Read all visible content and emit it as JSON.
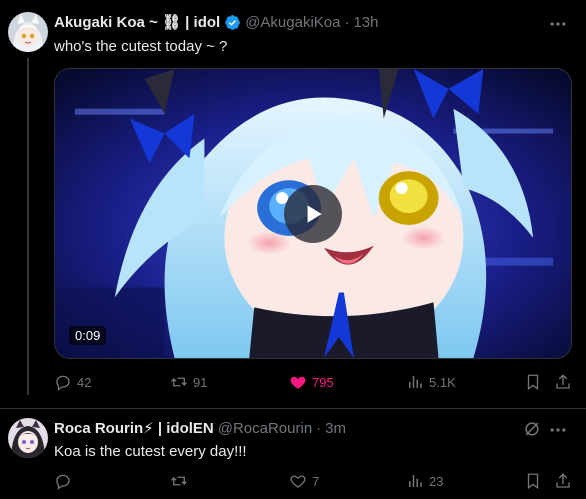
{
  "main_tweet": {
    "display_name": "Akugaki Koa ~ ⛓ | idol",
    "handle": "@AkugakiKoa",
    "dot": "·",
    "time": "13h",
    "text": "who's the cutest today ~ ?",
    "video": {
      "duration": "0:09"
    },
    "actions": {
      "reply_count": "42",
      "repost_count": "91",
      "like_count": "795",
      "views_count": "5.1K"
    }
  },
  "reply_tweet": {
    "display_name": "Roca Rourin⚡ | idolEN",
    "handle": "@RocaRourin",
    "dot": "·",
    "time": "3m",
    "text": "Koa is the cutest every day!!!",
    "actions": {
      "reply_count": "",
      "repost_count": "",
      "like_count": "7",
      "views_count": "23"
    }
  },
  "colors": {
    "background": "#000000",
    "text_primary": "#e7e9ea",
    "text_secondary": "#71767b",
    "verified_blue": "#1d9bf0",
    "like_pink": "#f91880",
    "divider": "#2f3336"
  },
  "icons": {
    "reply": "reply-icon",
    "repost": "repost-icon",
    "like": "heart-icon",
    "views": "views-icon",
    "bookmark": "bookmark-icon",
    "share": "share-icon",
    "more": "more-icon",
    "play": "play-icon",
    "verified": "verified-badge-icon",
    "grok": "grok-icon"
  }
}
